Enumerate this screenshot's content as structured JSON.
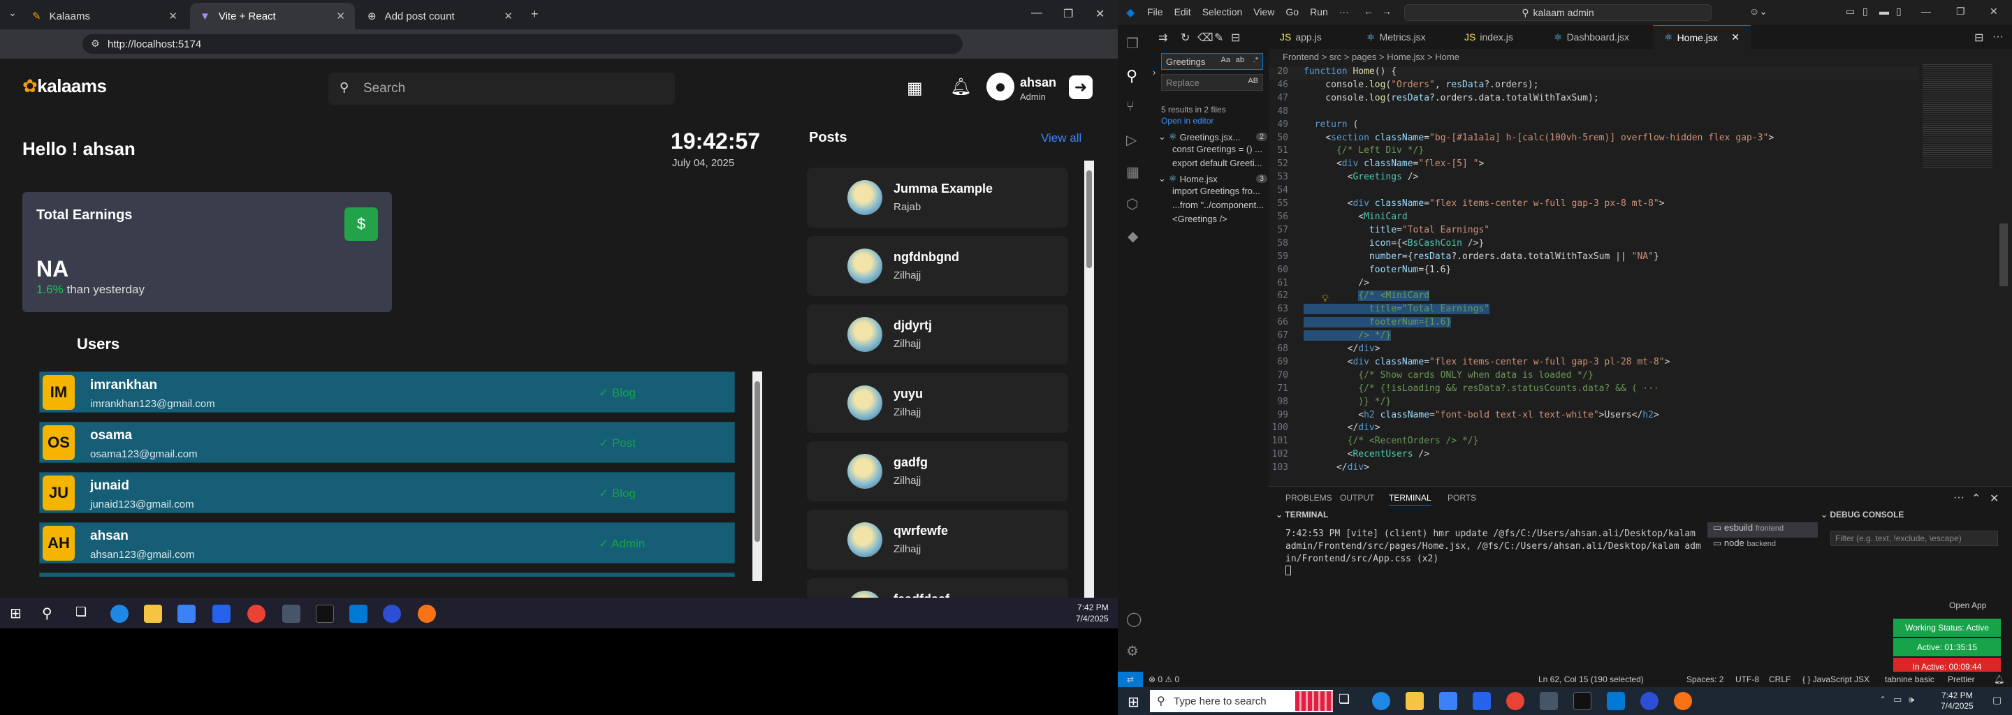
{
  "browser": {
    "tabs": [
      {
        "label": "Kalaams"
      },
      {
        "label": "Vite + React"
      },
      {
        "label": "Add post count"
      }
    ],
    "url": "http://localhost:5174"
  },
  "app": {
    "logo": "kalaams",
    "search_placeholder": "Search",
    "user": {
      "name": "ahsan",
      "role": "Admin"
    },
    "greeting": "Hello ! ahsan",
    "time": "19:42:57",
    "date": "July 04, 2025",
    "card": {
      "title": "Total Earnings",
      "number": "NA",
      "percent": "1.6%",
      "suffix": "than yesterday"
    },
    "users_heading": "Users",
    "users": [
      {
        "initials": "IM",
        "name": "imrankhan",
        "email": "imrankhan123@gmail.com",
        "role": "Blog"
      },
      {
        "initials": "OS",
        "name": "osama",
        "email": "osama123@gmail.com",
        "role": "Post"
      },
      {
        "initials": "JU",
        "name": "junaid",
        "email": "junaid123@gmail.com",
        "role": "Blog"
      },
      {
        "initials": "AH",
        "name": "ahsan",
        "email": "ahsan123@gmail.com",
        "role": "Admin"
      }
    ],
    "posts_heading": "Posts",
    "view_all": "View all",
    "posts": [
      {
        "title": "Jumma Example",
        "author": "Rajab"
      },
      {
        "title": "ngfdnbgnd",
        "author": "Zilhajj"
      },
      {
        "title": "djdyrtj",
        "author": "Zilhajj"
      },
      {
        "title": "yuyu",
        "author": "Zilhajj"
      },
      {
        "title": "gadfg",
        "author": "Zilhajj"
      },
      {
        "title": "qwrfewfe",
        "author": "Zilhajj"
      },
      {
        "title": "feadfdaaf",
        "author": ""
      }
    ]
  },
  "left_taskbar": {
    "time": "7:42 PM",
    "date": "7/4/2025"
  },
  "vscode": {
    "menu": [
      "File",
      "Edit",
      "Selection",
      "View",
      "Go",
      "Run",
      "···"
    ],
    "command_center": "kalaam admin",
    "tabs": [
      "app.js",
      "Metrics.jsx",
      "index.js",
      "Dashboard.jsx",
      "Home.jsx"
    ],
    "breadcrumb": "Frontend > src > pages > Home.jsx > Home",
    "search": {
      "find": "Greetings",
      "replace_placeholder": "Replace",
      "summary": "5 results in 2 files",
      "open_editor": "Open in editor",
      "files": [
        {
          "name": "Greetings.jsx...",
          "count": "2",
          "matches": [
            "const Greetings = () ...",
            "export default Greeti..."
          ]
        },
        {
          "name": "Home.jsx",
          "count": "3",
          "matches": [
            "import Greetings fro...",
            "...from \"../component...",
            "<Greetings />"
          ]
        }
      ]
    },
    "code_lines": [
      {
        "n": "20",
        "html": "<span class='kw'>function</span> <span class='fn'>Home</span>() {"
      },
      {
        "n": "46",
        "html": "    console.<span class='fn'>log</span>(<span class='str'>\"Orders\"</span>, <span class='at'>resData</span>?.orders);"
      },
      {
        "n": "47",
        "html": "    console.<span class='fn'>log</span>(<span class='at'>resData</span>?.orders.data.totalWithTaxSum);"
      },
      {
        "n": "48",
        "html": ""
      },
      {
        "n": "49",
        "html": "  <span class='kw'>return</span> ("
      },
      {
        "n": "50",
        "html": "    &lt;<span class='kw'>section</span> <span class='at'>className</span>=<span class='str'>\"bg-[#1a1a1a] h-[calc(100vh-5rem)] overflow-hidden flex gap-3\"</span>&gt;"
      },
      {
        "n": "51",
        "html": "      <span class='cm'>{/* Left Div */}</span>"
      },
      {
        "n": "52",
        "html": "      &lt;<span class='kw'>div</span> <span class='at'>className</span>=<span class='str'>\"flex-[5] \"</span>&gt;"
      },
      {
        "n": "53",
        "html": "        &lt;<span class='tag'>Greetings</span> /&gt;"
      },
      {
        "n": "54",
        "html": ""
      },
      {
        "n": "55",
        "html": "        &lt;<span class='kw'>div</span> <span class='at'>className</span>=<span class='str'>\"flex items-center w-full gap-3 px-8 mt-8\"</span>&gt;"
      },
      {
        "n": "56",
        "html": "          &lt;<span class='tag'>MiniCard</span>"
      },
      {
        "n": "57",
        "html": "            <span class='at'>title</span>=<span class='str'>\"Total Earnings\"</span>"
      },
      {
        "n": "58",
        "html": "            <span class='at'>icon</span>={&lt;<span class='tag'>BsCashCoin</span> /&gt;}"
      },
      {
        "n": "59",
        "html": "            <span class='at'>number</span>={<span class='at'>resData</span>?.orders.data.totalWithTaxSum || <span class='str'>\"NA\"</span>}"
      },
      {
        "n": "60",
        "html": "            <span class='at'>footerNum</span>={1.6}"
      },
      {
        "n": "61",
        "html": "          /&gt;"
      },
      {
        "n": "62",
        "html": "          <span class='hl'><span class='cm'>{/* &lt;MiniCard</span></span>"
      },
      {
        "n": "63",
        "html": "<span class='hl'><span class='cm'>            title=\"Total Earnings\"</span></span>"
      },
      {
        "n": "66",
        "html": "<span class='hl'><span class='cm'>            footerNum={1.6}</span></span>"
      },
      {
        "n": "67",
        "html": "<span class='hl'><span class='cm'>          /&gt; */}</span></span>"
      },
      {
        "n": "68",
        "html": "        &lt;/<span class='kw'>div</span>&gt;"
      },
      {
        "n": "69",
        "html": "        &lt;<span class='kw'>div</span> <span class='at'>className</span>=<span class='str'>\"flex items-center w-full gap-3 pl-28 mt-8\"</span>&gt;"
      },
      {
        "n": "70",
        "html": "          <span class='cm'>{/* Show cards ONLY when data is loaded */}</span>"
      },
      {
        "n": "71",
        "html": "          <span class='cm'>{/* {!isLoading &amp;&amp; resData?.statusCounts.data? &amp;&amp; ( ···</span>"
      },
      {
        "n": "98",
        "html": "          <span class='cm'>)} */}</span>"
      },
      {
        "n": "99",
        "html": "          &lt;<span class='kw'>h2</span> <span class='at'>className</span>=<span class='str'>\"font-bold text-xl text-white\"</span>&gt;Users&lt;/<span class='kw'>h2</span>&gt;"
      },
      {
        "n": "100",
        "html": "        &lt;/<span class='kw'>div</span>&gt;"
      },
      {
        "n": "101",
        "html": "        <span class='cm'>{/* &lt;RecentOrders /&gt; */}</span>"
      },
      {
        "n": "102",
        "html": "        &lt;<span class='tag'>RecentUsers</span> /&gt;"
      },
      {
        "n": "103",
        "html": "      &lt;/<span class='kw'>div</span>&gt;"
      }
    ],
    "panel_tabs": [
      "PROBLEMS",
      "OUTPUT",
      "TERMINAL",
      "PORTS"
    ],
    "terminal_title": "TERMINAL",
    "terminal_text": "7:42:53 PM [vite] (client) hmr update /@fs/C:/Users/ahsan.ali/Desktop/kalam admin/Frontend/src/pages/Home.jsx, /@fs/C:/Users/ahsan.ali/Desktop/kalam admin/Frontend/src/App.css (x2)",
    "terminals": [
      {
        "name": "esbuild",
        "label": "frontend"
      },
      {
        "name": "node",
        "label": "backend"
      }
    ],
    "debug_title": "DEBUG CONSOLE",
    "debug_filter": "Filter (e.g. text, !exclude, \\escape)",
    "open_app": "Open App",
    "working_status": "Working Status: Active",
    "active_time": "Active: 01:35:15",
    "inactive_time": "In Active: 00:09:44",
    "status": {
      "problems": "⊗ 0 ⚠ 0",
      "cursor": "Ln 62, Col 15 (190 selected)",
      "spaces": "Spaces: 2",
      "encoding": "UTF-8",
      "eol": "CRLF",
      "lang": "{ } JavaScript JSX",
      "tabnine": "tabnine basic",
      "prettier": "Prettier"
    }
  },
  "win_taskbar": {
    "search_placeholder": "Type here to search",
    "time": "7:42 PM",
    "date": "7/4/2025"
  }
}
